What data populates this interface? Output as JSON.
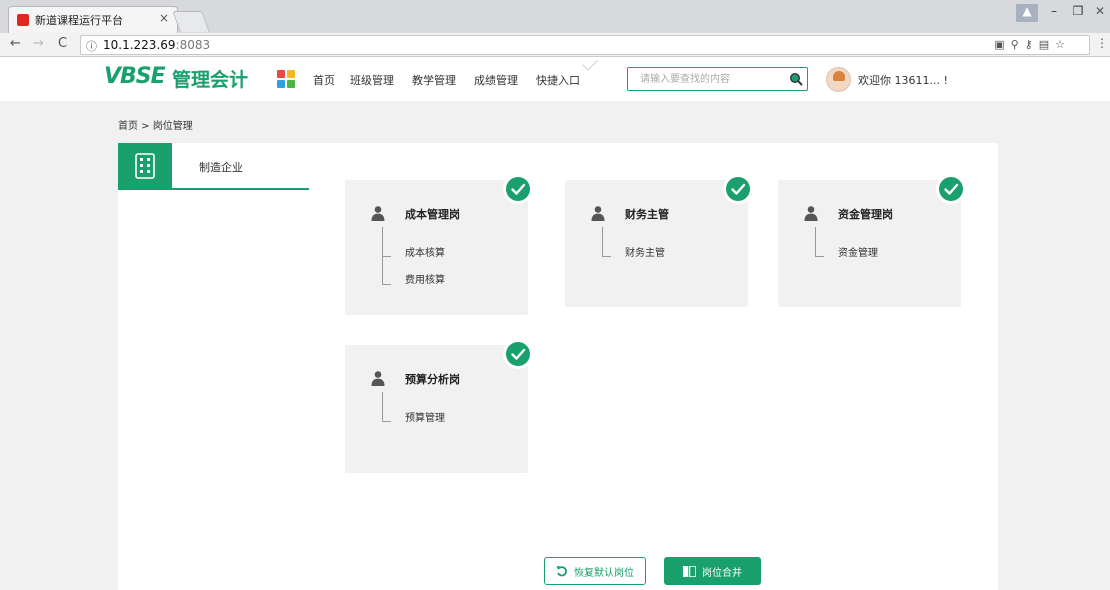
{
  "browser": {
    "tab_title": "新道课程运行平台",
    "tab_close": "×",
    "url_host": "10.1.223.69",
    "url_port": ":8083"
  },
  "header": {
    "logo_main": "VBSE",
    "logo_sub": "管理会计",
    "nav": [
      "首页",
      "班级管理",
      "教学管理",
      "成绩管理",
      "快捷入口"
    ],
    "search_placeholder": "请输入要查找的内容",
    "welcome": "欢迎你 13611... !"
  },
  "breadcrumb": "首页 > 岗位管理",
  "sidebar": {
    "company": "制造企业"
  },
  "posts": [
    {
      "title": "成本管理岗",
      "duties": [
        "成本核算",
        "费用核算"
      ],
      "checked": true
    },
    {
      "title": "财务主管",
      "duties": [
        "财务主管"
      ],
      "checked": true
    },
    {
      "title": "资金管理岗",
      "duties": [
        "资金管理"
      ],
      "checked": true
    },
    {
      "title": "预算分析岗",
      "duties": [
        "预算管理"
      ],
      "checked": true
    }
  ],
  "actions": {
    "restore": "恢复默认岗位",
    "merge": "岗位合并"
  },
  "colors": {
    "accent": "#1aa06d",
    "card_bg": "#f1f1f1"
  },
  "icons": {
    "company": "building-icon",
    "post": "person-icon",
    "check": "check-circle-icon",
    "search": "search-icon",
    "restore": "undo-icon",
    "merge": "merge-icon"
  }
}
